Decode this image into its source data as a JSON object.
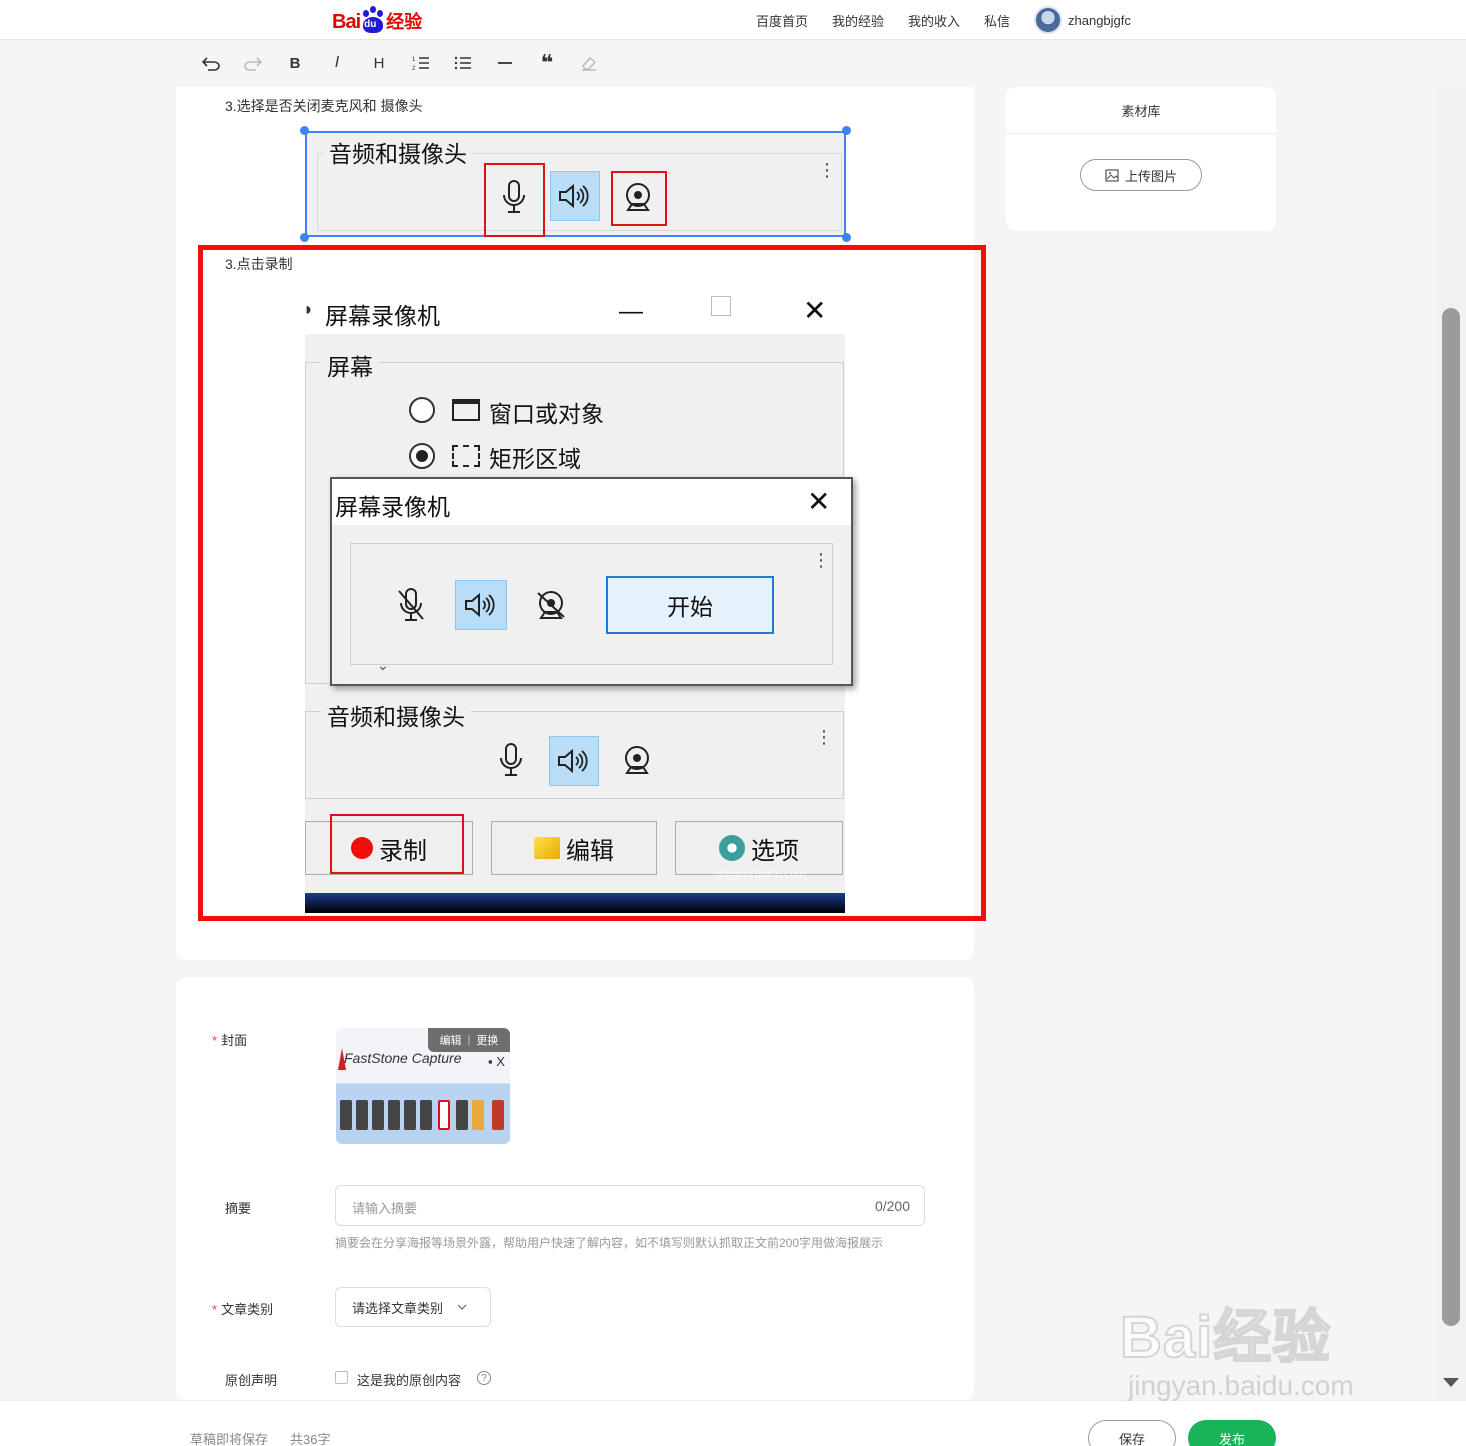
{
  "brand": {
    "logo_bai": "Bai",
    "logo_du": "du",
    "logo_jy": "经验"
  },
  "nav": {
    "links": [
      "百度首页",
      "我的经验",
      "我的收入",
      "私信"
    ],
    "username": "zhangbjgfc"
  },
  "toolbar": {
    "bold": "B",
    "italic": "I",
    "heading": "H"
  },
  "article": {
    "step1_text": "3.选择是否关闭麦克风和 摄像头",
    "step2_text": "3.点击录制",
    "image1": {
      "group_title": "音频和摄像头"
    },
    "image2": {
      "window_title": "屏幕录像机",
      "screen_group": "屏幕",
      "option_window": "窗口或对象",
      "option_rect": "矩形区域",
      "dialog_title": "屏幕录像机",
      "start_label": "开始",
      "audio_group": "音频和摄像头",
      "record_label": "录制",
      "edit_label": "编辑",
      "options_label": "选项",
      "watermark_url": "jingyan.baidu.com"
    }
  },
  "side": {
    "title": "素材库",
    "upload_label": "上传图片"
  },
  "meta": {
    "cover_label": "封面",
    "cover_edit": "编辑",
    "cover_change": "更换",
    "cover_image_text": "FastStone Capture",
    "summary_label": "摘要",
    "summary_placeholder": "请输入摘要",
    "summary_count": "0/200",
    "summary_hint": "摘要会在分享海报等场景外露，帮助用户快速了解内容，如不填写则默认抓取正文前200字用做海报展示",
    "category_label": "文章类别",
    "category_placeholder": "请选择文章类别",
    "original_label": "原创声明",
    "original_checkbox": "这是我的原创内容"
  },
  "footer": {
    "draft_status": "草稿即将保存",
    "word_count": "共36字",
    "save_label": "保存",
    "publish_label": "发布"
  },
  "watermark": {
    "text": "Bai经验",
    "url": "jingyan.baidu.com"
  },
  "colors": {
    "accent_blue": "#3a84f5",
    "highlight_red": "#f00e0e",
    "publish_green": "#19b35a"
  }
}
